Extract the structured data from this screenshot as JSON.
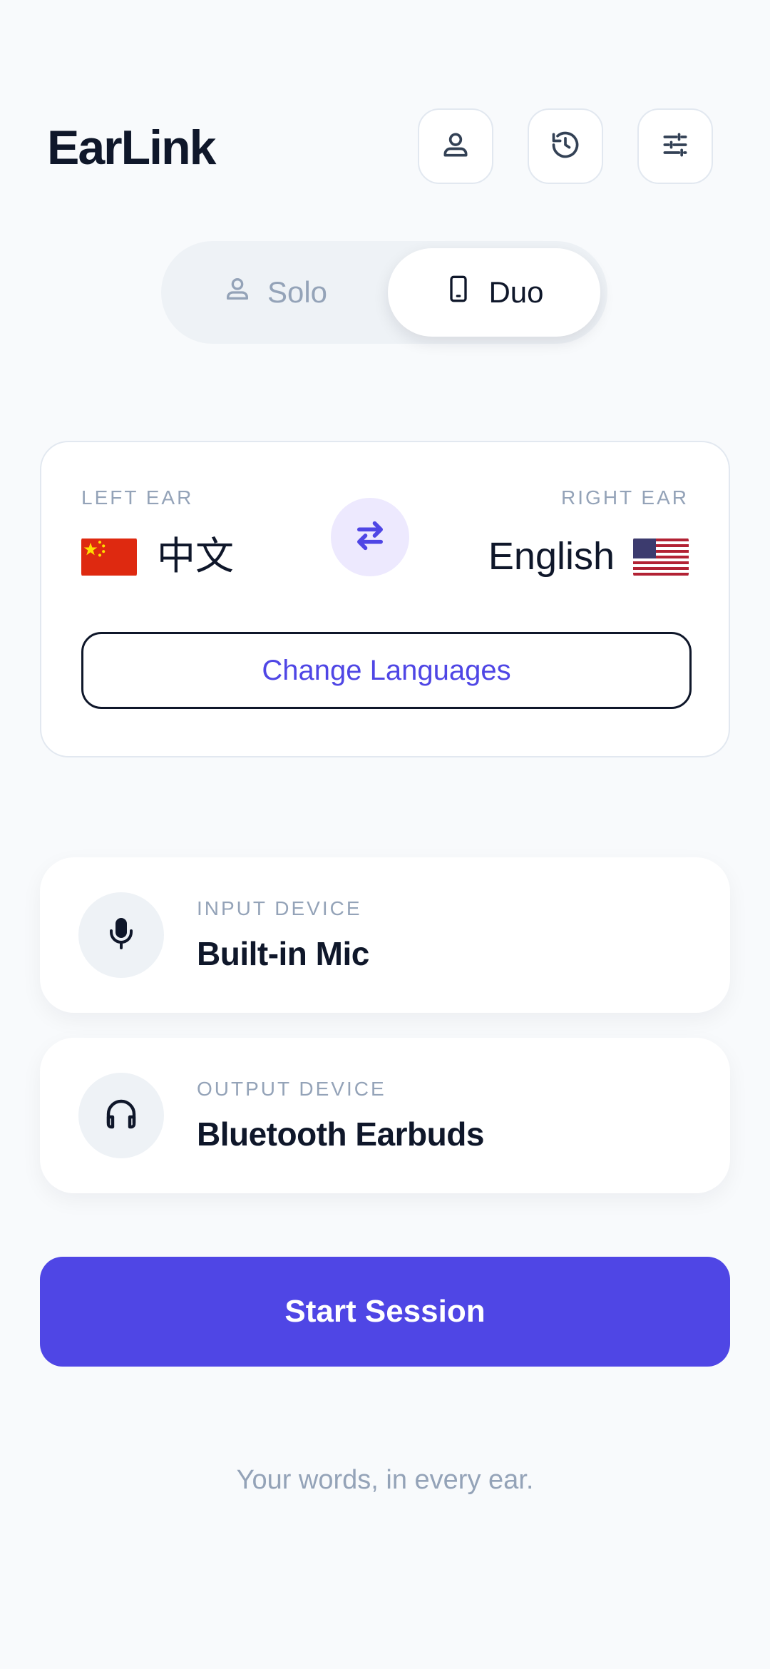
{
  "app": {
    "title": "EarLink"
  },
  "header": {
    "buttons": [
      {
        "icon": "user-icon"
      },
      {
        "icon": "history-icon"
      },
      {
        "icon": "sliders-icon"
      }
    ]
  },
  "mode_toggle": {
    "options": [
      {
        "label": "Solo",
        "icon": "user-icon"
      },
      {
        "label": "Duo",
        "icon": "phone-icon"
      }
    ],
    "selected": "Duo"
  },
  "languages": {
    "left_ear_label": "LEFT EAR",
    "right_ear_label": "RIGHT EAR",
    "left_language": "中文",
    "right_language": "English",
    "left_flag": "china-flag-icon",
    "right_flag": "usa-flag-icon",
    "swap_icon": "swap-arrows-icon",
    "change_label": "Change Languages"
  },
  "devices": {
    "input": {
      "label": "INPUT DEVICE",
      "value": "Built-in Mic",
      "icon": "microphone-icon"
    },
    "output": {
      "label": "OUTPUT DEVICE",
      "value": "Bluetooth Earbuds",
      "icon": "headphones-icon"
    }
  },
  "actions": {
    "start_label": "Start Session"
  },
  "footer": {
    "tagline": "Your words, in every ear."
  },
  "colors": {
    "accent": "#4f46e5",
    "accent_soft": "#ede9fe",
    "text_primary": "#0f172a",
    "text_muted": "#94a3b8",
    "background": "#f8fafc"
  }
}
